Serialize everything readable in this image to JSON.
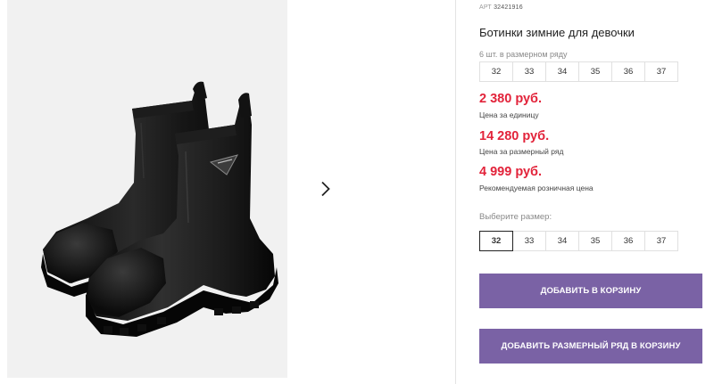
{
  "product": {
    "art_label": "АРТ",
    "art_number": "32421916",
    "title": "Ботинки зимние для девочки"
  },
  "series": {
    "label": "6 шт. в размерном ряду",
    "sizes": [
      "32",
      "33",
      "34",
      "35",
      "36",
      "37"
    ]
  },
  "prices": [
    {
      "value": "2 380 руб.",
      "note": "Цена за единицу"
    },
    {
      "value": "14 280 руб.",
      "note": "Цена за размерный ряд"
    },
    {
      "value": "4 999 руб.",
      "note": "Рекомендуемая розничная цена"
    }
  ],
  "size_select": {
    "label": "Выберите размер:",
    "sizes": [
      "32",
      "33",
      "34",
      "35",
      "36",
      "37"
    ],
    "selected": "32"
  },
  "buttons": {
    "add_to_cart": "ДОБАВИТЬ В КОРЗИНУ",
    "add_series_to_cart": "ДОБАВИТЬ РАЗМЕРНЫЙ РЯД В КОРЗИНУ"
  },
  "gallery": {
    "next_icon": "chevron-right-icon"
  },
  "colors": {
    "price_red": "#e2233a",
    "button_purple": "#7a62a5",
    "photo_bg": "#f1f1f1"
  }
}
